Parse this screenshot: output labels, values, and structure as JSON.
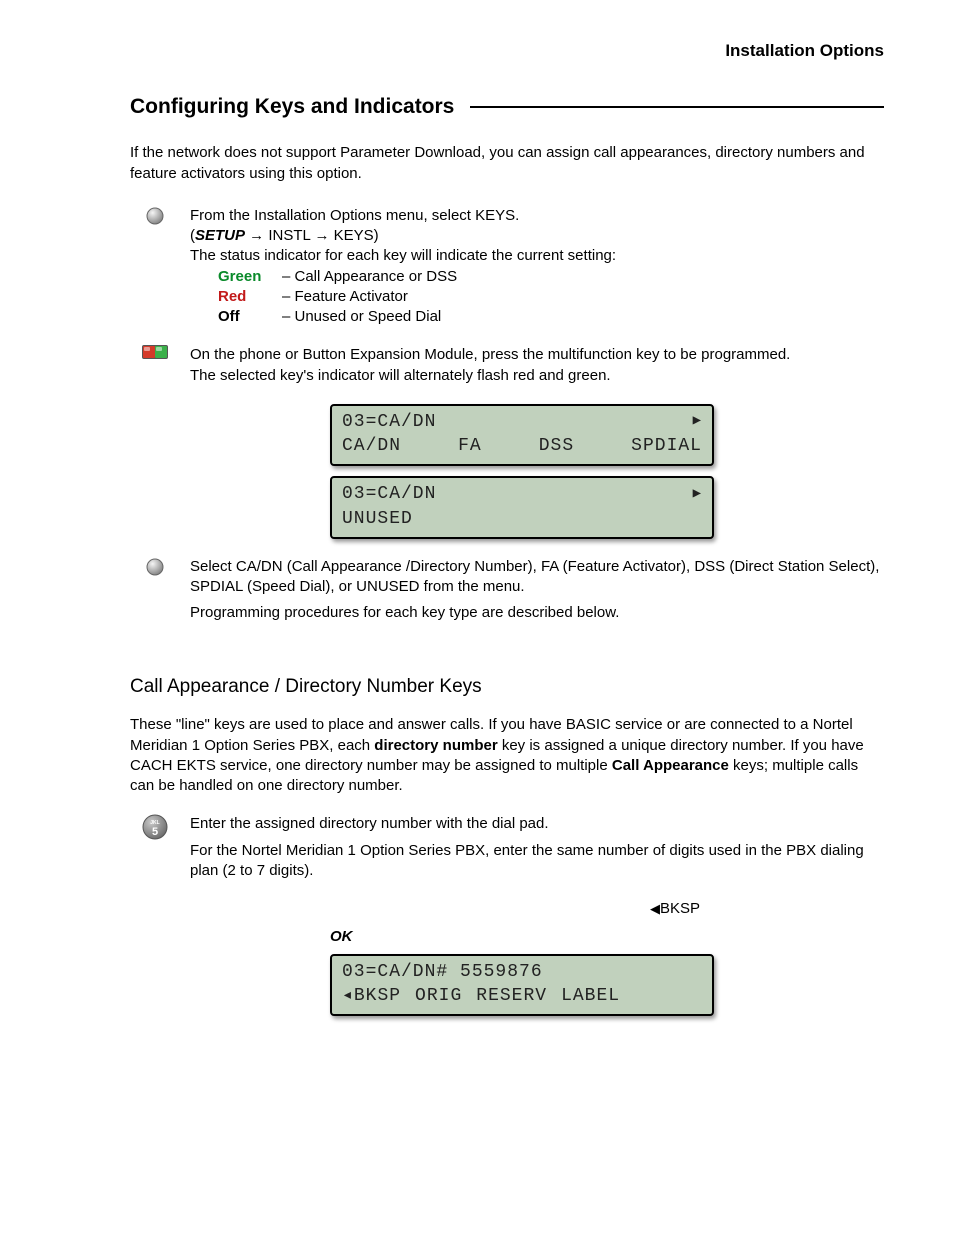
{
  "header": {
    "right": "Installation Options"
  },
  "section1": {
    "title": "Configuring Keys and Indicators",
    "intro": "If the network does not support Parameter Download, you can assign call appearances, directory numbers and feature activators using this option."
  },
  "step1": {
    "line1": "From the Installation Options menu, select KEYS.",
    "setup": "SETUP",
    "path_rest": " → INSTL → KEYS)",
    "line2": "The status indicator for each key will indicate the current setting:",
    "status": {
      "green_label": "Green",
      "green_text": "– Call Appearance or DSS",
      "red_label": "Red",
      "red_text": "– Feature Activator",
      "off_label": "Off",
      "off_text": "– Unused or Speed Dial"
    }
  },
  "step2": {
    "line1": "On the phone or Button Expansion Module, press the multifunction key to be programmed.",
    "line2": "The selected key's indicator will alternately flash red and green."
  },
  "lcd1": {
    "r1": "03=CA/DN",
    "r2a": "CA/DN",
    "r2b": "FA",
    "r2c": "DSS",
    "r2d": "SPDIAL"
  },
  "lcd2": {
    "r1": "03=CA/DN",
    "r2": "UNUSED"
  },
  "step3": {
    "line1": "Select CA/DN (Call Appearance /Directory Number), FA (Feature Activator), DSS (Direct Station Select), SPDIAL (Speed Dial), or UNUSED from the menu.",
    "line2": "Programming procedures for each key type are described below."
  },
  "section2": {
    "title": "Call Appearance / Directory Number Keys",
    "p1a": "These \"line\" keys are used to place and answer calls. If you have BASIC service or are connected to a Nortel Meridian 1 Option Series PBX, each ",
    "p1b": "directory number",
    "p1c": " key is assigned a unique directory number. If you have CACH EKTS service, one directory number may be assigned to multiple ",
    "p1d": "Call Appearance",
    "p1e": " keys; multiple calls can be handled on one directory number."
  },
  "step4": {
    "line1": "Enter the assigned directory number with the dial pad.",
    "line2": "For the Nortel Meridian 1 Option Series PBX, enter the same number of digits used in the PBX dialing plan (2 to 7 digits)."
  },
  "bksp": "BKSP",
  "ok": "OK",
  "lcd3": {
    "r1": "03=CA/DN# 5559876",
    "r2a": "◂BKSP",
    "r2b": "ORIG",
    "r2c": "RESERV",
    "r2d": "LABEL"
  }
}
